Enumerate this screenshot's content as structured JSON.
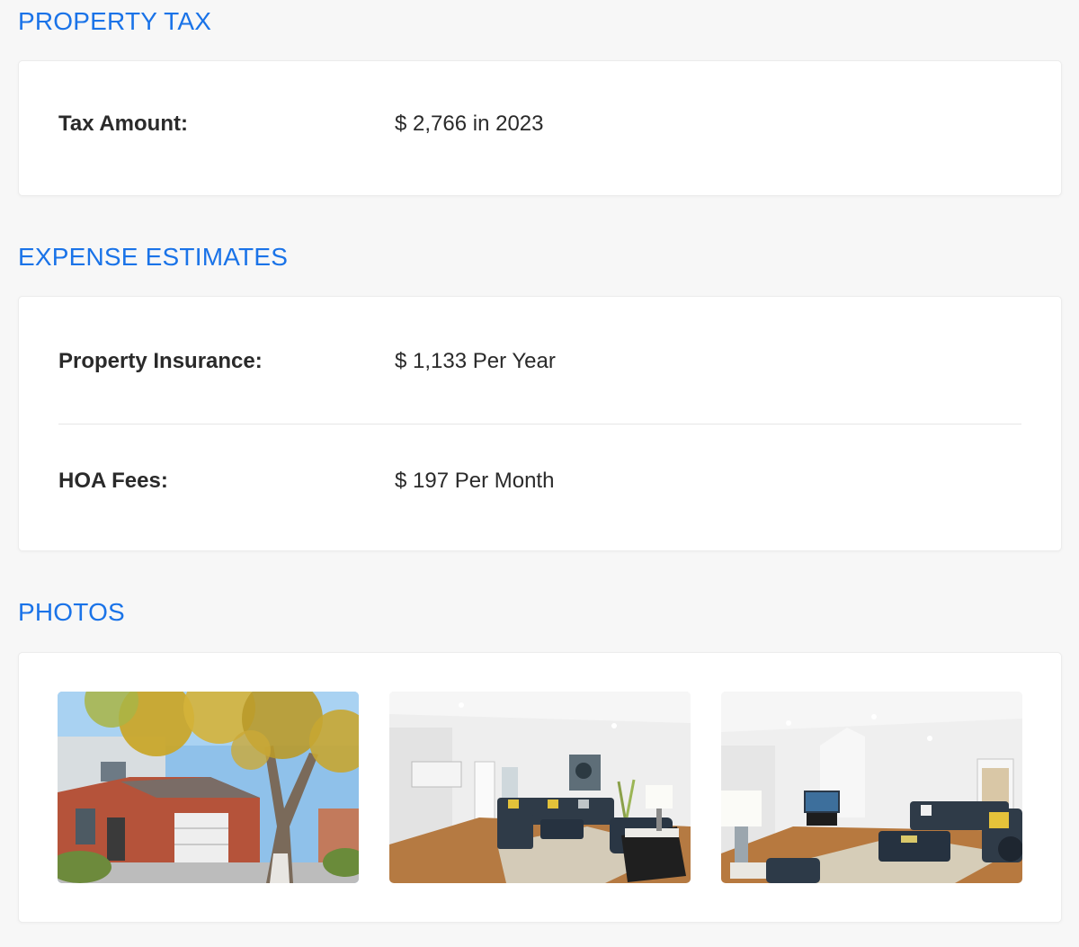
{
  "property_tax": {
    "title": "PROPERTY TAX",
    "rows": [
      {
        "label": "Tax Amount:",
        "value": "$ 2,766 in 2023"
      }
    ]
  },
  "expense_estimates": {
    "title": "EXPENSE ESTIMATES",
    "rows": [
      {
        "label": "Property Insurance:",
        "value": "$ 1,133 Per Year"
      },
      {
        "label": "HOA Fees:",
        "value": "$ 197 Per Month"
      }
    ]
  },
  "photos": {
    "title": "PHOTOS",
    "items": [
      {
        "name": "exterior-photo"
      },
      {
        "name": "living-room-photo-1"
      },
      {
        "name": "living-room-photo-2"
      }
    ]
  },
  "colors": {
    "accent": "#1a73e8",
    "background": "#f7f7f7",
    "card": "#ffffff",
    "text": "#2a2a2a"
  }
}
